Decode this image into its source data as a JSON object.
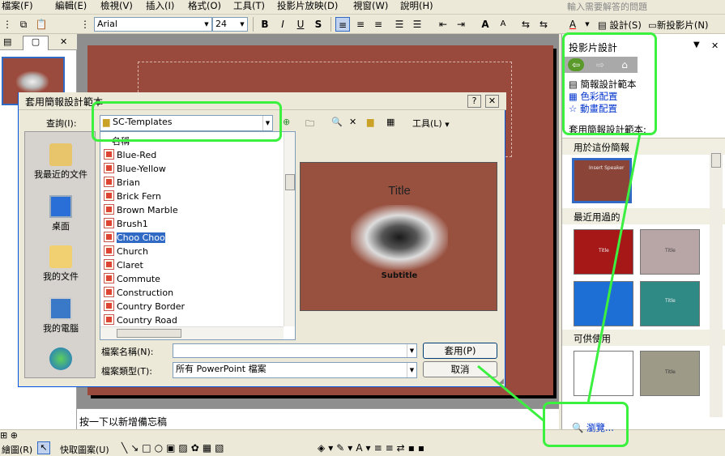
{
  "menus": [
    "檔案(F)",
    "編輯(E)",
    "檢視(V)",
    "插入(I)",
    "格式(O)",
    "工具(T)",
    "投影片放映(D)",
    "視窗(W)",
    "說明(H)"
  ],
  "help_placeholder": "輸入需要解答的問題",
  "toolbar": {
    "font": "Arial",
    "size": "24",
    "design_label": "設計(S)",
    "new_slide_label": "新投影片(N)"
  },
  "notes_placeholder": "按一下以新增備忘稿",
  "drawbar": {
    "draw_label": "繪圖(R)",
    "autoshape_label": "快取圖案(U)"
  },
  "taskpane": {
    "title": "投影片設計",
    "links": [
      "簡報設計範本",
      "色彩配置",
      "動畫配置"
    ],
    "apply_label": "套用簡報設計範本:",
    "sections": [
      "用於這份簡報",
      "最近用過的",
      "可供使用"
    ],
    "browse_label": "瀏覽...",
    "thumb_texts": {
      "current": "Insert Speaker",
      "recent_red": "Title",
      "recent_gray": "Title",
      "recent_teal": "Title",
      "avail_gray": "Title"
    }
  },
  "dialog": {
    "title": "套用簡報設計範本",
    "lookin_label": "查詢(I):",
    "lookin_value": "SC-Templates",
    "tools_label": "工具(L)",
    "column_header": "名稱",
    "places": [
      "我最近的文件",
      "桌面",
      "我的文件",
      "我的電腦"
    ],
    "files": [
      "Blue-Red",
      "Blue-Yellow",
      "Brian",
      "Brick Fern",
      "Brown Marble",
      "Brush1",
      "Choo Choo",
      "Church",
      "Claret",
      "Commute",
      "Construction",
      "Country Border",
      "Country Road"
    ],
    "selected": "Choo Choo",
    "preview_title": "Title",
    "preview_subtitle": "Subtitle",
    "filename_label": "檔案名稱(N):",
    "filetype_label": "檔案類型(T):",
    "filetype_value": "所有 PowerPoint 檔案",
    "apply_button": "套用(P)",
    "cancel_button": "取消"
  },
  "colors": {
    "highlight": "#3cf040",
    "slide_bg": "#9a4a3c",
    "selection": "#316ac5"
  }
}
